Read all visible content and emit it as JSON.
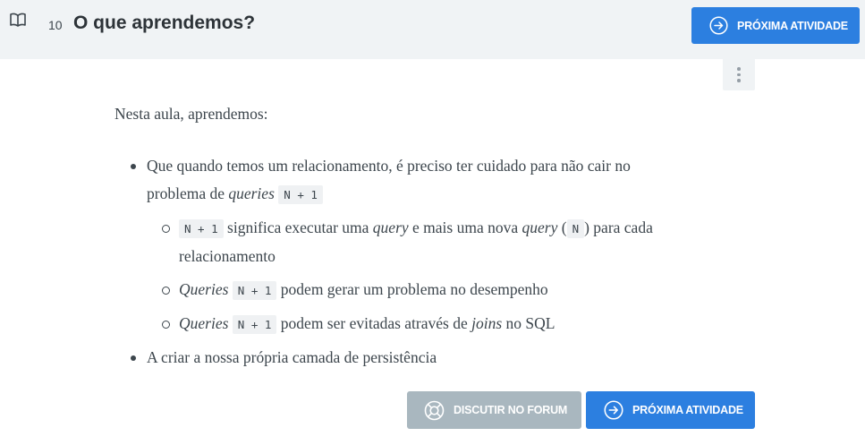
{
  "header": {
    "lesson_number": "10",
    "title": "O que aprendemos?",
    "next_button_label": "PRÓXIMA ATIVIDADE"
  },
  "content": {
    "intro": "Nesta aula, aprendemos:",
    "item1": {
      "text_a": "Que quando temos um relacionamento, é preciso ter cuidado para não cair no problema de ",
      "em": "queries",
      "code": "N + 1"
    },
    "sub1": {
      "code": "N + 1",
      "text_a": " significa executar uma ",
      "em_a": "query",
      "text_b": " e mais uma nova ",
      "em_b": "query",
      "text_c": " (",
      "code_b": "N",
      "text_d": ") para cada relacionamento"
    },
    "sub2": {
      "em": "Queries",
      "code": "N + 1",
      "text": " podem gerar um problema no desempenho"
    },
    "sub3": {
      "em": "Queries",
      "code": "N + 1",
      "text_a": " podem ser evitadas através de ",
      "em_b": "joins",
      "text_b": " no SQL"
    },
    "item2": "A criar a nossa própria camada de persistência"
  },
  "footer": {
    "forum_button_label": "DISCUTIR NO FORUM",
    "next_button_label": "PRÓXIMA ATIVIDADE"
  },
  "colors": {
    "primary": "#2c7fe0",
    "disabled": "#a9b7bf",
    "header_bg": "#f0f3f5"
  },
  "icons": [
    "book-icon",
    "arrow-right-circle-icon",
    "lifebuoy-icon",
    "more-vertical-icon"
  ]
}
